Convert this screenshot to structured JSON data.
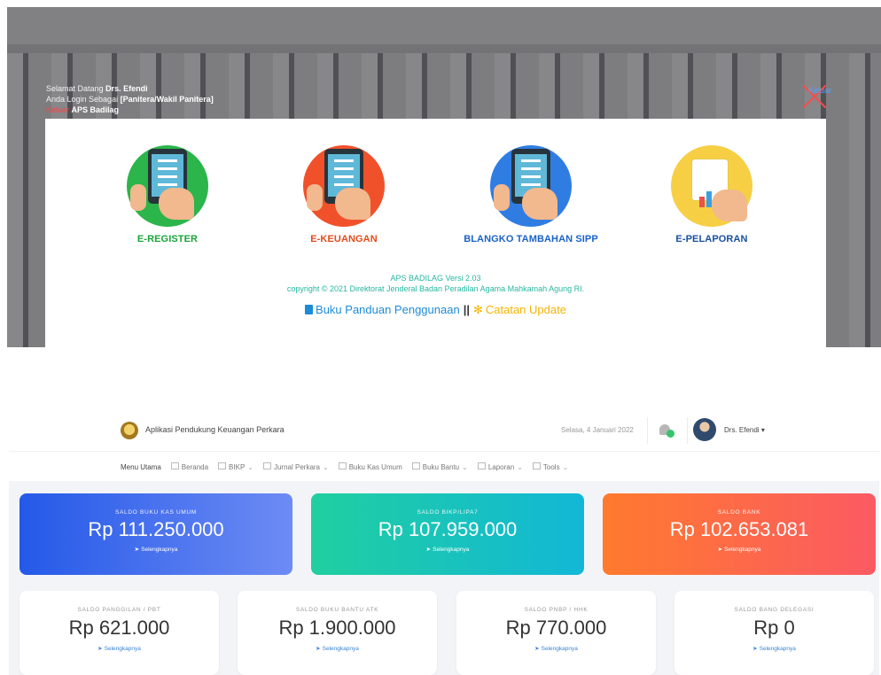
{
  "splash": {
    "welcome_line1_prefix": "Selamat Datang",
    "welcome_user": "Drs. Efendi",
    "welcome_line2_prefix": "Anda Login Sebagai",
    "welcome_role": "[Panitera/Wakil Panitera]",
    "logout_label": "Keluar",
    "logout_suffix": "APS Badilag",
    "close_label": "Keluar",
    "tiles": [
      {
        "label": "E-REGISTER",
        "color": "#1aa33a",
        "circle": "#2bb54a"
      },
      {
        "label": "E-KEUANGAN",
        "color": "#e24b1b",
        "circle": "#f0512b"
      },
      {
        "label": "BLANGKO TAMBAHAN SIPP",
        "color": "#1a62c9",
        "circle": "#2f7de3"
      },
      {
        "label": "E-PELAPORAN",
        "color": "#174f9e",
        "circle": "#f7cf45"
      }
    ],
    "version": "APS BADILAG Versi 2.03",
    "copyright": "copyright © 2021 Direktorat Jenderal Badan Peradilan Agama Mahkamah Agung RI.",
    "guide_label": "Buku Panduan Penggunaan",
    "separator": "||",
    "update_label": "Catatan Update"
  },
  "dashboard": {
    "app_name": "Aplikasi Pendukung Keuangan Perkara",
    "date": "Selasa, 4 Januari 2022",
    "user_name": "Drs. Efendi",
    "nav": [
      {
        "label": "Menu Utama",
        "chevron": false
      },
      {
        "label": "Beranda",
        "chevron": false
      },
      {
        "label": "BIKP",
        "chevron": true
      },
      {
        "label": "Jurnal Perkara",
        "chevron": true
      },
      {
        "label": "Buku Kas Umum",
        "chevron": false
      },
      {
        "label": "Buku Bantu",
        "chevron": true
      },
      {
        "label": "Laporan",
        "chevron": true
      },
      {
        "label": "Tools",
        "chevron": true
      }
    ],
    "big_cards": [
      {
        "title": "SALDO BUKU KAS UMUM",
        "value": "Rp 111.250.000",
        "more": "Selengkapnya",
        "gradient": [
          "#2459e8",
          "#6d8bf4"
        ]
      },
      {
        "title": "SALDO BIKP/LIPA7",
        "value": "Rp 107.959.000",
        "more": "Selengkapnya",
        "gradient": [
          "#20cfa0",
          "#12b7d6"
        ]
      },
      {
        "title": "SALDO BANK",
        "value": "Rp 102.653.081",
        "more": "Selengkapnya",
        "gradient": [
          "#ff7a2e",
          "#fb5a63"
        ]
      }
    ],
    "small_cards": [
      {
        "title": "SALDO PANGGILAN / PBT",
        "value": "Rp 621.000",
        "more": "Selengkapnya"
      },
      {
        "title": "SALDO BUKU BANTU ATK",
        "value": "Rp 1.900.000",
        "more": "Selengkapnya"
      },
      {
        "title": "SALDO PNBP / HHK",
        "value": "Rp 770.000",
        "more": "Selengkapnya"
      },
      {
        "title": "SALDO BANG DELEGASI",
        "value": "Rp 0",
        "more": "Selengkapnya"
      }
    ]
  }
}
